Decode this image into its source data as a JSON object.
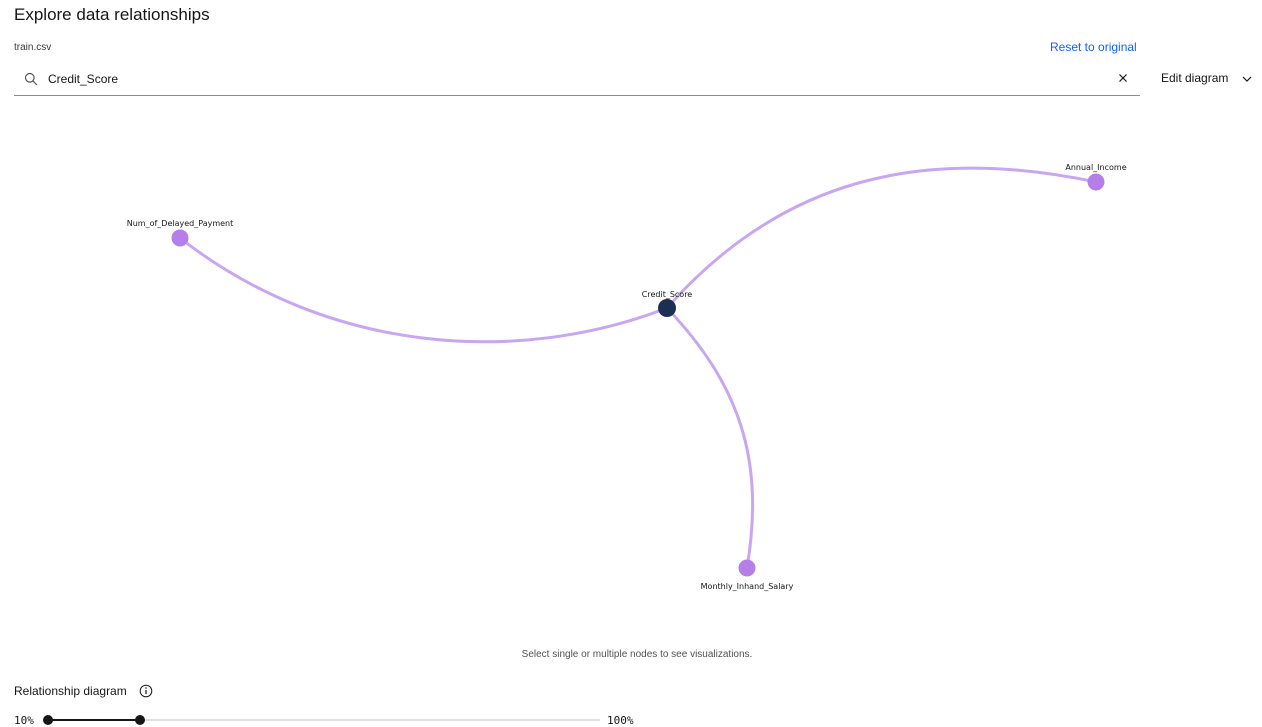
{
  "header": {
    "title": "Explore data relationships",
    "filename": "train.csv",
    "reset_label": "Reset to original"
  },
  "search": {
    "value": "Credit_Score",
    "icon": "search-icon",
    "clear_icon": "close-icon"
  },
  "edit_diagram": {
    "label": "Edit diagram",
    "icon": "chevron-down-icon"
  },
  "diagram": {
    "center_node": "Credit_Score",
    "nodes": [
      {
        "id": "credit",
        "label": "Credit_Score",
        "type": "selected"
      },
      {
        "id": "annual",
        "label": "Annual_Income",
        "type": "related"
      },
      {
        "id": "delayed",
        "label": "Num_of_Delayed_Payment",
        "type": "related"
      },
      {
        "id": "salary",
        "label": "Monthly_Inhand_Salary",
        "type": "related"
      }
    ],
    "edges": [
      {
        "from": "credit",
        "to": "annual"
      },
      {
        "from": "credit",
        "to": "delayed"
      },
      {
        "from": "credit",
        "to": "salary"
      }
    ],
    "colors": {
      "selected_node": "#1c2f52",
      "related_node": "#b57ee8",
      "edge": "#c9a6f0"
    }
  },
  "hint": "Select single or multiple nodes to see visualizations.",
  "relationship": {
    "label": "Relationship diagram",
    "info_icon": "info-icon",
    "slider": {
      "min_label": "10%",
      "max_label": "100%",
      "min": 10,
      "max": 100,
      "low": 10,
      "high": 25
    }
  }
}
